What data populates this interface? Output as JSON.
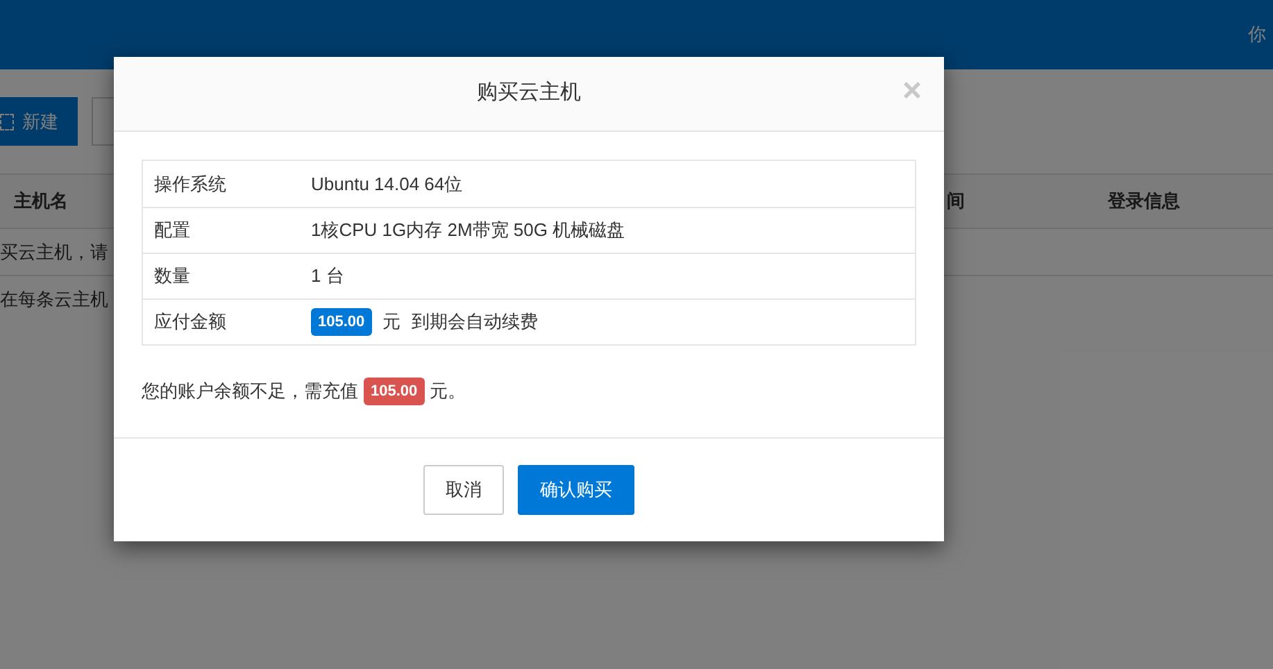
{
  "header": {
    "greeting": "你"
  },
  "toolbar": {
    "new_button": "新建"
  },
  "table": {
    "columns": [
      "主机名",
      "间",
      "登录信息"
    ],
    "rows": [
      "买云主机，请",
      "在每条云主机"
    ]
  },
  "dialog": {
    "title": "购买云主机",
    "close": "×",
    "details": [
      {
        "label": "操作系统",
        "value": "Ubuntu 14.04 64位"
      },
      {
        "label": "配置",
        "value": "1核CPU 1G内存 2M带宽 50G 机械磁盘"
      },
      {
        "label": "数量",
        "value": "1 台"
      },
      {
        "label": "应付金额",
        "amount": "105.00",
        "unit": "元",
        "note": "到期会自动续费"
      }
    ],
    "notice": {
      "before": "您的账户余额不足，需充值",
      "amount": "105.00",
      "after": "元。"
    },
    "buttons": [
      {
        "label": "取消",
        "kind": "default"
      },
      {
        "label": "确认购买",
        "kind": "primary"
      }
    ]
  }
}
